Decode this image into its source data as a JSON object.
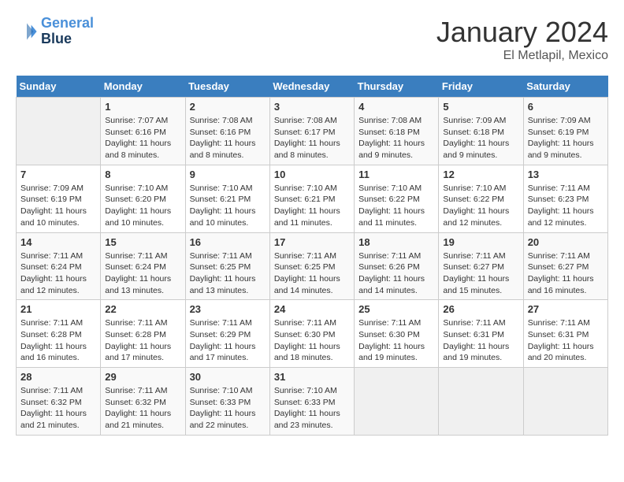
{
  "header": {
    "logo_line1": "General",
    "logo_line2": "Blue",
    "title": "January 2024",
    "subtitle": "El Metlapil, Mexico"
  },
  "days_of_week": [
    "Sunday",
    "Monday",
    "Tuesday",
    "Wednesday",
    "Thursday",
    "Friday",
    "Saturday"
  ],
  "weeks": [
    [
      {
        "day": "",
        "detail": ""
      },
      {
        "day": "1",
        "detail": "Sunrise: 7:07 AM\nSunset: 6:16 PM\nDaylight: 11 hours\nand 8 minutes."
      },
      {
        "day": "2",
        "detail": "Sunrise: 7:08 AM\nSunset: 6:16 PM\nDaylight: 11 hours\nand 8 minutes."
      },
      {
        "day": "3",
        "detail": "Sunrise: 7:08 AM\nSunset: 6:17 PM\nDaylight: 11 hours\nand 8 minutes."
      },
      {
        "day": "4",
        "detail": "Sunrise: 7:08 AM\nSunset: 6:18 PM\nDaylight: 11 hours\nand 9 minutes."
      },
      {
        "day": "5",
        "detail": "Sunrise: 7:09 AM\nSunset: 6:18 PM\nDaylight: 11 hours\nand 9 minutes."
      },
      {
        "day": "6",
        "detail": "Sunrise: 7:09 AM\nSunset: 6:19 PM\nDaylight: 11 hours\nand 9 minutes."
      }
    ],
    [
      {
        "day": "7",
        "detail": "Sunrise: 7:09 AM\nSunset: 6:19 PM\nDaylight: 11 hours\nand 10 minutes."
      },
      {
        "day": "8",
        "detail": "Sunrise: 7:10 AM\nSunset: 6:20 PM\nDaylight: 11 hours\nand 10 minutes."
      },
      {
        "day": "9",
        "detail": "Sunrise: 7:10 AM\nSunset: 6:21 PM\nDaylight: 11 hours\nand 10 minutes."
      },
      {
        "day": "10",
        "detail": "Sunrise: 7:10 AM\nSunset: 6:21 PM\nDaylight: 11 hours\nand 11 minutes."
      },
      {
        "day": "11",
        "detail": "Sunrise: 7:10 AM\nSunset: 6:22 PM\nDaylight: 11 hours\nand 11 minutes."
      },
      {
        "day": "12",
        "detail": "Sunrise: 7:10 AM\nSunset: 6:22 PM\nDaylight: 11 hours\nand 12 minutes."
      },
      {
        "day": "13",
        "detail": "Sunrise: 7:11 AM\nSunset: 6:23 PM\nDaylight: 11 hours\nand 12 minutes."
      }
    ],
    [
      {
        "day": "14",
        "detail": "Sunrise: 7:11 AM\nSunset: 6:24 PM\nDaylight: 11 hours\nand 12 minutes."
      },
      {
        "day": "15",
        "detail": "Sunrise: 7:11 AM\nSunset: 6:24 PM\nDaylight: 11 hours\nand 13 minutes."
      },
      {
        "day": "16",
        "detail": "Sunrise: 7:11 AM\nSunset: 6:25 PM\nDaylight: 11 hours\nand 13 minutes."
      },
      {
        "day": "17",
        "detail": "Sunrise: 7:11 AM\nSunset: 6:25 PM\nDaylight: 11 hours\nand 14 minutes."
      },
      {
        "day": "18",
        "detail": "Sunrise: 7:11 AM\nSunset: 6:26 PM\nDaylight: 11 hours\nand 14 minutes."
      },
      {
        "day": "19",
        "detail": "Sunrise: 7:11 AM\nSunset: 6:27 PM\nDaylight: 11 hours\nand 15 minutes."
      },
      {
        "day": "20",
        "detail": "Sunrise: 7:11 AM\nSunset: 6:27 PM\nDaylight: 11 hours\nand 16 minutes."
      }
    ],
    [
      {
        "day": "21",
        "detail": "Sunrise: 7:11 AM\nSunset: 6:28 PM\nDaylight: 11 hours\nand 16 minutes."
      },
      {
        "day": "22",
        "detail": "Sunrise: 7:11 AM\nSunset: 6:28 PM\nDaylight: 11 hours\nand 17 minutes."
      },
      {
        "day": "23",
        "detail": "Sunrise: 7:11 AM\nSunset: 6:29 PM\nDaylight: 11 hours\nand 17 minutes."
      },
      {
        "day": "24",
        "detail": "Sunrise: 7:11 AM\nSunset: 6:30 PM\nDaylight: 11 hours\nand 18 minutes."
      },
      {
        "day": "25",
        "detail": "Sunrise: 7:11 AM\nSunset: 6:30 PM\nDaylight: 11 hours\nand 19 minutes."
      },
      {
        "day": "26",
        "detail": "Sunrise: 7:11 AM\nSunset: 6:31 PM\nDaylight: 11 hours\nand 19 minutes."
      },
      {
        "day": "27",
        "detail": "Sunrise: 7:11 AM\nSunset: 6:31 PM\nDaylight: 11 hours\nand 20 minutes."
      }
    ],
    [
      {
        "day": "28",
        "detail": "Sunrise: 7:11 AM\nSunset: 6:32 PM\nDaylight: 11 hours\nand 21 minutes."
      },
      {
        "day": "29",
        "detail": "Sunrise: 7:11 AM\nSunset: 6:32 PM\nDaylight: 11 hours\nand 21 minutes."
      },
      {
        "day": "30",
        "detail": "Sunrise: 7:10 AM\nSunset: 6:33 PM\nDaylight: 11 hours\nand 22 minutes."
      },
      {
        "day": "31",
        "detail": "Sunrise: 7:10 AM\nSunset: 6:33 PM\nDaylight: 11 hours\nand 23 minutes."
      },
      {
        "day": "",
        "detail": ""
      },
      {
        "day": "",
        "detail": ""
      },
      {
        "day": "",
        "detail": ""
      }
    ]
  ]
}
